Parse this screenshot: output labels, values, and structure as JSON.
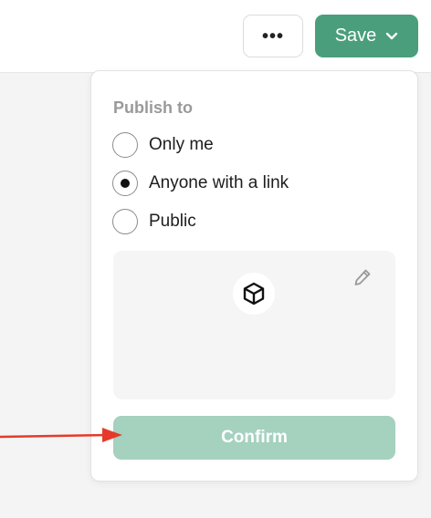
{
  "toolbar": {
    "more_label": "•••",
    "save_label": "Save"
  },
  "publish": {
    "title": "Publish to",
    "options": [
      {
        "label": "Only me",
        "selected": false
      },
      {
        "label": "Anyone with a link",
        "selected": true
      },
      {
        "label": "Public",
        "selected": false
      }
    ]
  },
  "card": {
    "icon": "cube-icon",
    "edit_icon": "pencil-icon"
  },
  "confirm_label": "Confirm",
  "colors": {
    "accent": "#4a9e7c",
    "confirm_disabled": "#a5d1bf",
    "annotation_arrow": "#e53a2a"
  }
}
